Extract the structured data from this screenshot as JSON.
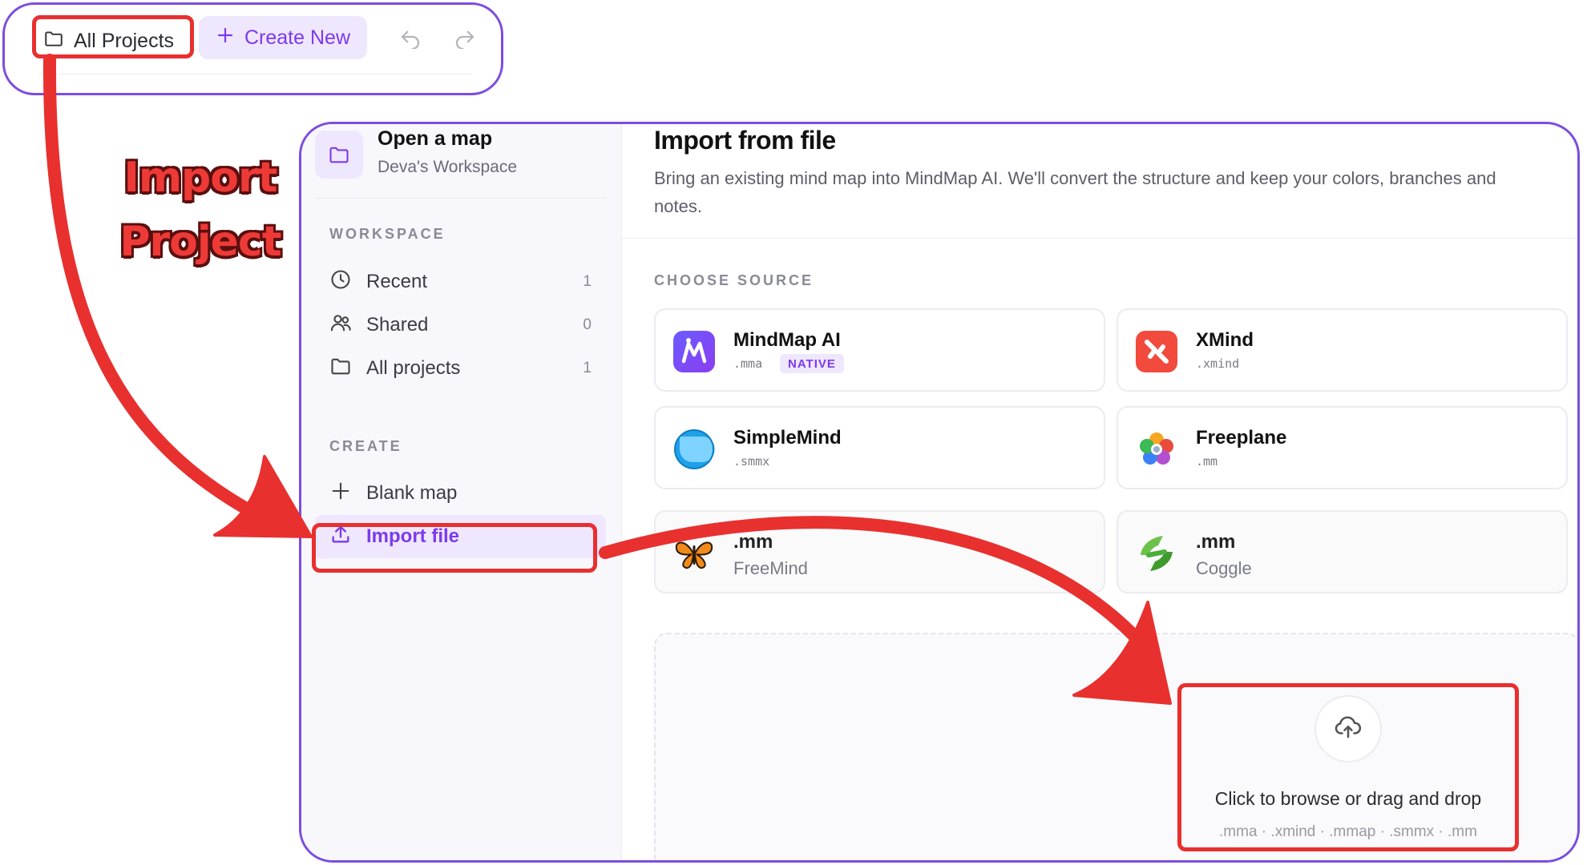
{
  "toolbar": {
    "all_projects_label": "All Projects",
    "create_new_label": "Create New",
    "icons": [
      "folder-icon",
      "plus-icon",
      "undo-icon",
      "redo-icon"
    ]
  },
  "annotation": {
    "line1": "Import",
    "line2": "Project",
    "color": "#e8302f"
  },
  "sidebar": {
    "workspace_title": "Open a map",
    "workspace_name": "Deva's Workspace",
    "section_workspace": "WORKSPACE",
    "items": [
      {
        "label": "Recent",
        "count": "1",
        "icon": "clock-icon"
      },
      {
        "label": "Shared",
        "count": "0",
        "icon": "users-icon"
      },
      {
        "label": "All projects",
        "count": "1",
        "icon": "folder-icon"
      }
    ],
    "section_create": "CREATE",
    "create_items": [
      {
        "label": "Blank map",
        "icon": "plus-icon"
      },
      {
        "label": "Import file",
        "icon": "upload-icon",
        "active": true
      }
    ]
  },
  "main": {
    "title": "Import from file",
    "description": "Bring an existing mind map into MindMap AI. We'll convert the structure and keep your colors, branches and notes.",
    "choose_source_label": "CHOOSE SOURCE",
    "sources": [
      {
        "name": "MindMap AI",
        "ext": ".mma",
        "badge": "NATIVE"
      },
      {
        "name": "XMind",
        "ext": ".xmind"
      },
      {
        "name": "SimpleMind",
        "ext": ".smmx"
      },
      {
        "name": "Freeplane",
        "ext": ".mm"
      },
      {
        "name": ".mm",
        "subtitle": "FreeMind"
      },
      {
        "name": ".mm",
        "subtitle": "Coggle"
      }
    ],
    "dropzone": {
      "text": "Click to browse or drag and drop",
      "formats": ".mma · .xmind · .mmap · .smmx · .mm"
    }
  },
  "colors": {
    "accent": "#7c3aed",
    "frame": "#7c4dde",
    "highlight": "#e8302f"
  }
}
